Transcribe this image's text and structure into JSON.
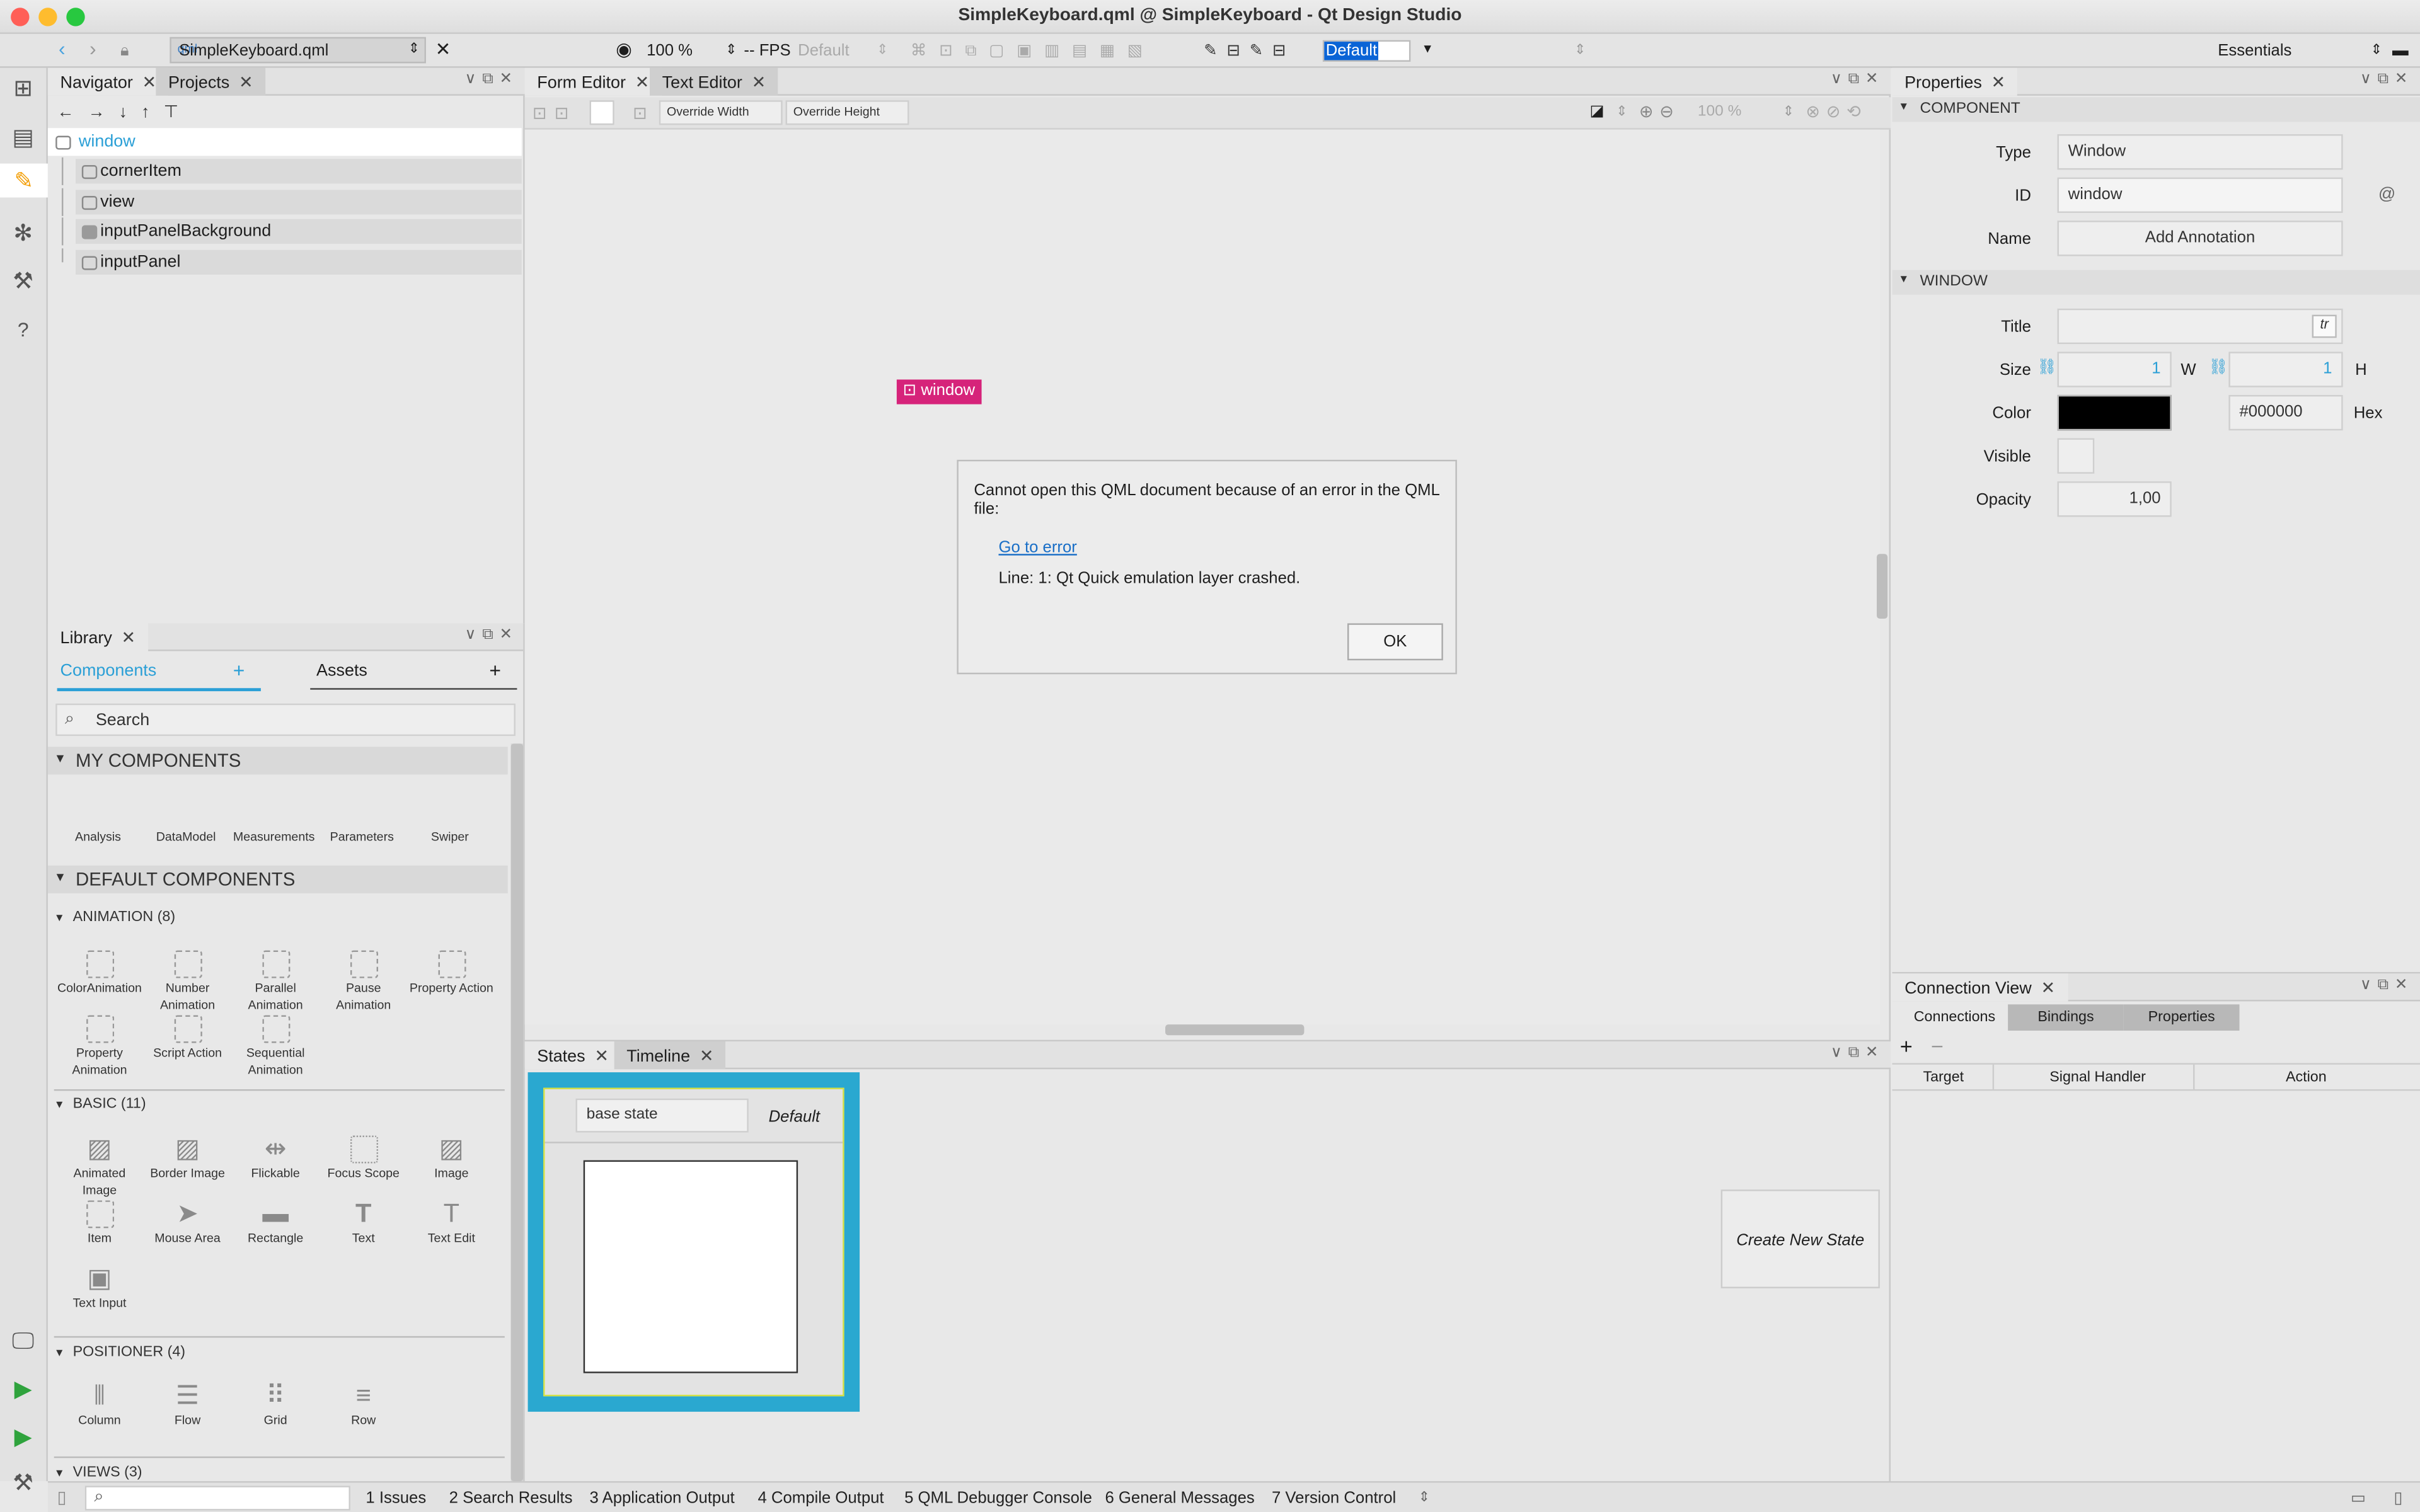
{
  "window": {
    "title": "SimpleKeyboard.qml @ SimpleKeyboard - Qt Design Studio"
  },
  "toolbar": {
    "file": "SimpleKeyboard.qml",
    "zoom": "100 %",
    "fps": "-- FPS",
    "fps_mode": "Default",
    "state": "Default",
    "workspace": "Essentials"
  },
  "navigator": {
    "tab": "Navigator",
    "tab2": "Projects",
    "items": [
      {
        "label": "window"
      },
      {
        "label": "cornerItem"
      },
      {
        "label": "view"
      },
      {
        "label": "inputPanelBackground"
      },
      {
        "label": "inputPanel"
      }
    ]
  },
  "library": {
    "tab": "Library",
    "components_tab": "Components",
    "assets_tab": "Assets",
    "search_placeholder": "Search",
    "my_components": {
      "title": "MY COMPONENTS",
      "items": [
        "Analysis",
        "DataModel",
        "Measurements",
        "Parameters",
        "Swiper"
      ]
    },
    "default_components": "DEFAULT COMPONENTS",
    "animation": {
      "title": "ANIMATION (8)",
      "items": [
        "ColorAnimation",
        "Number Animation",
        "Parallel Animation",
        "Pause Animation",
        "Property Action",
        "Property Animation",
        "Script Action",
        "Sequential Animation"
      ]
    },
    "basic": {
      "title": "BASIC (11)",
      "items": [
        "Animated Image",
        "Border Image",
        "Flickable",
        "Focus Scope",
        "Image",
        "Item",
        "Mouse Area",
        "Rectangle",
        "Text",
        "Text Edit",
        "Text Input"
      ]
    },
    "positioner": {
      "title": "POSITIONER (4)",
      "items": [
        "Column",
        "Flow",
        "Grid",
        "Row"
      ]
    },
    "views": {
      "title": "VIEWS (3)"
    }
  },
  "editor": {
    "tab": "Form Editor",
    "tab2": "Text Editor",
    "override_width": "Override Width",
    "override_height": "Override Height",
    "zoom": "100 %",
    "window_label": "window"
  },
  "error_dialog": {
    "message": "Cannot open this QML document because of an error in the QML file:",
    "link": "Go to error",
    "detail": "Line: 1: Qt Quick emulation layer crashed.",
    "ok": "OK"
  },
  "states": {
    "tab": "States",
    "tab2": "Timeline",
    "base_state": "base state",
    "default": "Default",
    "create": "Create New State"
  },
  "properties": {
    "tab": "Properties",
    "component_section": "COMPONENT",
    "type_label": "Type",
    "type_value": "Window",
    "id_label": "ID",
    "id_value": "window",
    "name_label": "Name",
    "add_annotation": "Add Annotation",
    "window_section": "WINDOW",
    "title_label": "Title",
    "tr": "tr",
    "size_label": "Size",
    "w_value": "1",
    "w_label": "W",
    "h_value": "1",
    "h_label": "H",
    "color_label": "Color",
    "color_value": "#000000",
    "hex": "Hex",
    "visible_label": "Visible",
    "opacity_label": "Opacity",
    "opacity_value": "1,00",
    "color_swatch": "#000000"
  },
  "connections": {
    "tab": "Connection View",
    "tabs": [
      "Connections",
      "Bindings",
      "Properties"
    ],
    "cols": [
      "Target",
      "Signal Handler",
      "Action"
    ]
  },
  "status": {
    "items": [
      "1  Issues",
      "2  Search Results",
      "3  Application Output",
      "4  Compile Output",
      "5  QML Debugger Console",
      "6  General Messages",
      "7  Version Control"
    ]
  }
}
